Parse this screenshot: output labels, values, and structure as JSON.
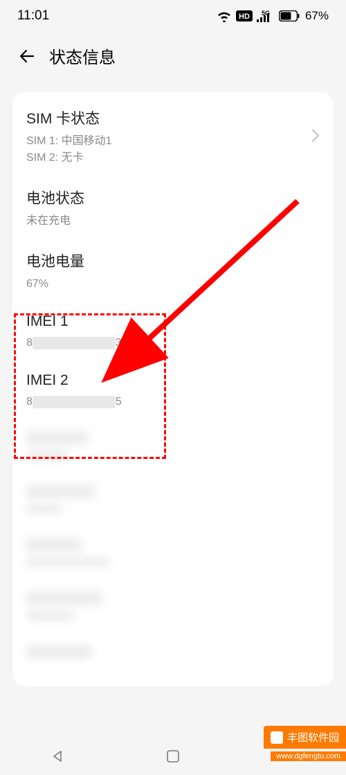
{
  "statusBar": {
    "time": "11:01",
    "battery": "67%",
    "networkLabel": "5G",
    "hdLabel": "HD"
  },
  "header": {
    "title": "状态信息"
  },
  "items": {
    "sim": {
      "title": "SIM 卡状态",
      "sub1": "SIM 1: 中国移动1",
      "sub2": "SIM 2: 无卡"
    },
    "batteryStatus": {
      "title": "电池状态",
      "sub": "未在充电"
    },
    "batteryLevel": {
      "title": "电池电量",
      "sub": "67%"
    },
    "imei1": {
      "title": "IMEI 1",
      "prefix": "8",
      "suffix": "3"
    },
    "imei2": {
      "title": "IMEI 2",
      "prefix": "8",
      "suffix": "5"
    }
  },
  "watermark": {
    "text": "丰图软件园",
    "url": "www.dgfengtu.com"
  }
}
